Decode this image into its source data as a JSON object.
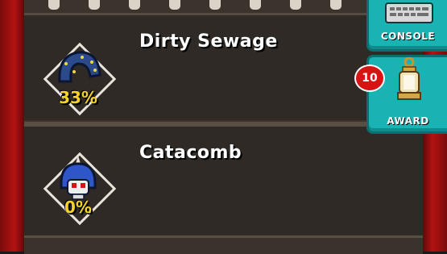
{
  "levels": [
    {
      "name": "Dirty Sewage",
      "progress_label": "33%",
      "progress": 0.33,
      "icon": "sewer-serpent-icon"
    },
    {
      "name": "Catacomb",
      "progress_label": "0%",
      "progress": 0.0,
      "icon": "skull-ghost-icon"
    }
  ],
  "side_buttons": {
    "console": {
      "label": "CONSOLE",
      "icon": "keyboard-icon"
    },
    "award": {
      "label": "AWARD",
      "icon": "trophy-lantern-icon",
      "badge_count": "10"
    }
  },
  "colors": {
    "side_border_red": "#b31212",
    "panel_bg": "#2f2a25",
    "button_teal": "#19b3b3",
    "percent_yellow": "#f5d326",
    "badge_red": "#d81313"
  }
}
